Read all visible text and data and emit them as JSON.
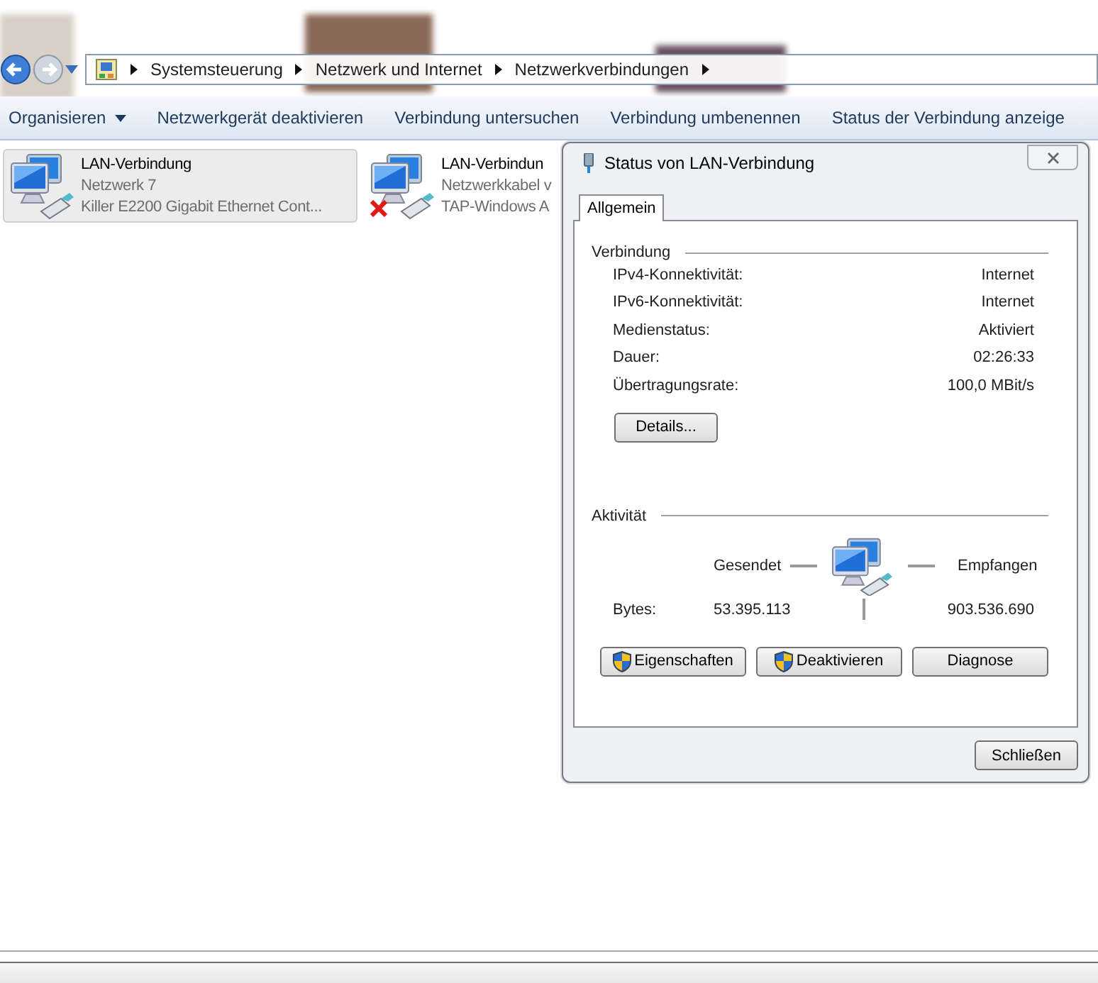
{
  "breadcrumb": [
    "Systemsteuerung",
    "Netzwerk und Internet",
    "Netzwerkverbindungen"
  ],
  "toolbar": [
    {
      "label": "Organisieren",
      "kind": "menu"
    },
    {
      "label": "Netzwerkgerät deaktivieren",
      "kind": "action"
    },
    {
      "label": "Verbindung untersuchen",
      "kind": "action"
    },
    {
      "label": "Verbindung umbenennen",
      "kind": "action"
    },
    {
      "label": "Status der Verbindung anzeige",
      "kind": "action"
    }
  ],
  "connections": [
    {
      "name": "LAN-Verbindung",
      "network": "Netzwerk  7",
      "adapter": "Killer E2200 Gigabit Ethernet Cont...",
      "selected": true,
      "disconnected": false
    },
    {
      "name": "LAN-Verbindun",
      "network": "Netzwerkkabel v",
      "adapter": "TAP-Windows A",
      "selected": false,
      "disconnected": true
    }
  ],
  "dialog": {
    "title": "Status von LAN-Verbindung",
    "tabs": [
      {
        "label": "Allgemein",
        "selected": true
      }
    ],
    "connection_group": {
      "title": "Verbindung",
      "rows": [
        {
          "label": "IPv4-Konnektivität:",
          "value": "Internet"
        },
        {
          "label": "IPv6-Konnektivität:",
          "value": "Internet"
        },
        {
          "label": "Medienstatus:",
          "value": "Aktiviert"
        },
        {
          "label": "Dauer:",
          "value": "02:26:33"
        },
        {
          "label": "Übertragungsrate:",
          "value": "100,0 MBit/s"
        }
      ],
      "details_button": "Details..."
    },
    "activity_group": {
      "title": "Aktivität",
      "sent_label": "Gesendet",
      "received_label": "Empfangen",
      "bytes_label": "Bytes:",
      "bytes_sent": "53.395.113",
      "bytes_received": "903.536.690"
    },
    "buttons": [
      {
        "label": "Eigenschaften",
        "kind": "shield"
      },
      {
        "label": "Deaktivieren",
        "kind": "shield"
      },
      {
        "label": "Diagnose",
        "kind": "plain"
      }
    ],
    "close_button": "Schließen"
  }
}
